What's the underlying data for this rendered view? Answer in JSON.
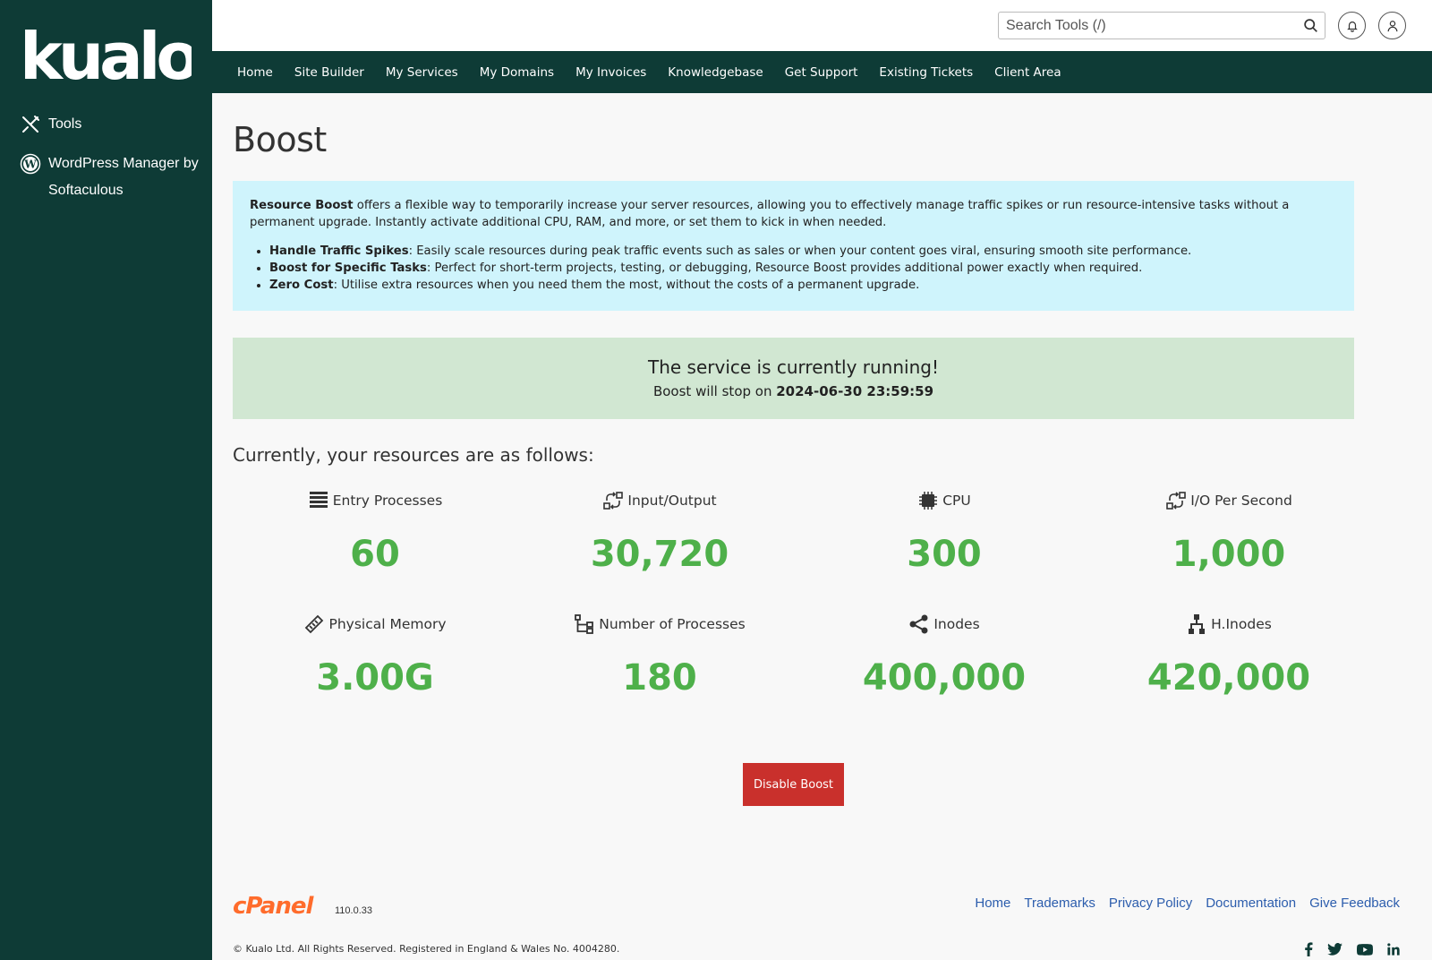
{
  "brand": {
    "logo_text": "kualo"
  },
  "sidebar": {
    "items": [
      {
        "label": "Tools",
        "icon": "tools-icon"
      },
      {
        "label": "WordPress Manager by Softaculous",
        "icon": "wordpress-icon"
      }
    ]
  },
  "topbar": {
    "search_placeholder": "Search Tools (/)",
    "search_value": ""
  },
  "nav": {
    "items": [
      "Home",
      "Site Builder",
      "My Services",
      "My Domains",
      "My Invoices",
      "Knowledgebase",
      "Get Support",
      "Existing Tickets",
      "Client Area"
    ]
  },
  "page": {
    "title": "Boost"
  },
  "info": {
    "lead_bold": "Resource Boost",
    "lead_text": " offers a flexible way to temporarily increase your server resources, allowing you to effectively manage traffic spikes or run resource-intensive tasks without a permanent upgrade. Instantly activate additional CPU, RAM, and more, or set them to kick in when needed.",
    "bullets": [
      {
        "bold": "Handle Traffic Spikes",
        "text": ": Easily scale resources during peak traffic events such as sales or when your content goes viral, ensuring smooth site performance."
      },
      {
        "bold": "Boost for Specific Tasks",
        "text": ": Perfect for short-term projects, testing, or debugging, Resource Boost provides additional power exactly when required."
      },
      {
        "bold": "Zero Cost",
        "text": ": Utilise extra resources when you need them the most, without the costs of a permanent upgrade."
      }
    ]
  },
  "status": {
    "title": "The service is currently running!",
    "sub_prefix": "Boost will stop on ",
    "stop_time": "2024-06-30 23:59:59"
  },
  "resources": {
    "title": "Currently, your resources are as follows:",
    "items": [
      {
        "label": "Entry Processes",
        "value": "60",
        "icon": "list-icon"
      },
      {
        "label": "Input/Output",
        "value": "30,720",
        "icon": "io-icon"
      },
      {
        "label": "CPU",
        "value": "300",
        "icon": "cpu-icon"
      },
      {
        "label": "I/O Per Second",
        "value": "1,000",
        "icon": "iops-icon"
      },
      {
        "label": "Physical Memory",
        "value": "3.00G",
        "icon": "memory-icon"
      },
      {
        "label": "Number of Processes",
        "value": "180",
        "icon": "process-tree-icon"
      },
      {
        "label": "Inodes",
        "value": "400,000",
        "icon": "share-icon"
      },
      {
        "label": "H.Inodes",
        "value": "420,000",
        "icon": "sitemap-icon"
      }
    ]
  },
  "actions": {
    "disable_label": "Disable Boost"
  },
  "footer": {
    "cpanel_text": "cPanel",
    "version": "110.0.33",
    "links": [
      "Home",
      "Trademarks",
      "Privacy Policy",
      "Documentation",
      "Give Feedback"
    ],
    "copyright": "© Kualo Ltd. All Rights Reserved. Registered in England & Wales No. 4004280."
  },
  "colors": {
    "sidebar": "#0e3b36",
    "accent_green": "#4eb04a",
    "danger": "#c9302c",
    "info_bg": "#cff4fc",
    "success_bg": "#d1e7d2",
    "link": "#2c5dad"
  }
}
